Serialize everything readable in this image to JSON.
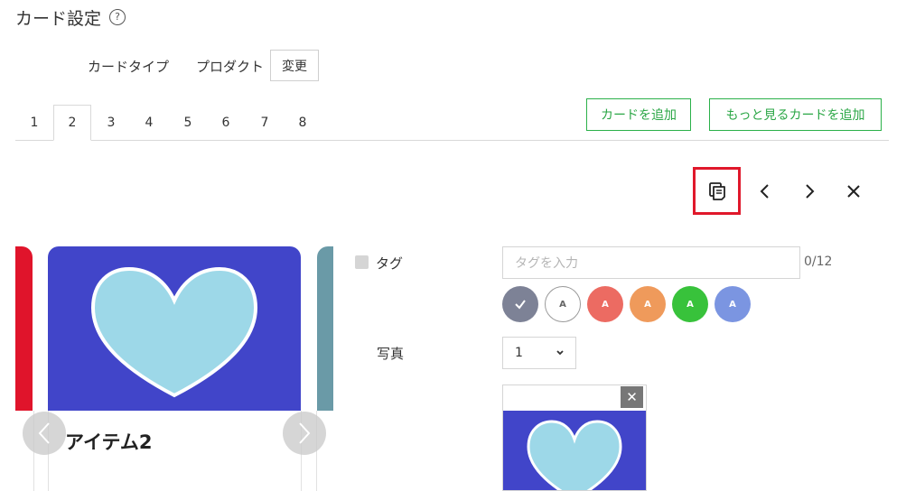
{
  "header": {
    "title": "カード設定",
    "help_glyph": "?"
  },
  "card_type": {
    "label": "カードタイプ",
    "value": "プロダクト",
    "change_label": "変更"
  },
  "tabs": [
    "1",
    "2",
    "3",
    "4",
    "5",
    "6",
    "7",
    "8"
  ],
  "active_tab": "2",
  "actions": {
    "add_card": "カードを追加",
    "add_more_card": "もっと見るカードを追加"
  },
  "card": {
    "title": "アイテム2"
  },
  "form": {
    "tag_label": "タグ",
    "tag_placeholder": "タグを入力",
    "tag_count": "0/12",
    "swatch_letter": "A",
    "photo_label": "写真",
    "photo_value": "1"
  },
  "colors": {
    "accent_green": "#2aa645",
    "highlight_red": "#e0182b",
    "card_blue": "#4145c9",
    "heart": "#9dd8e8",
    "swatches": [
      "#7d8296",
      "#ffffff",
      "#ec6b62",
      "#ef9a5b",
      "#38c23b",
      "#7b95e1"
    ]
  }
}
